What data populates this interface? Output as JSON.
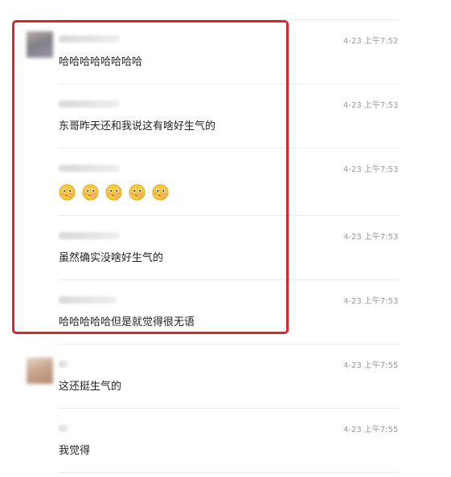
{
  "messages": [
    {
      "time": "4-23 上午7:52",
      "text": "哈哈哈哈哈哈哈哈"
    },
    {
      "time": "4-23 上午7:53",
      "text": "东哥昨天还和我说这有啥好生气的"
    },
    {
      "time": "4-23 上午7:53",
      "emoji": [
        "smiling-face-emoji",
        "smiling-face-emoji",
        "smiling-face-emoji",
        "smiling-face-emoji",
        "smiling-face-emoji"
      ]
    },
    {
      "time": "4-23 上午7:53",
      "text": "虽然确实没啥好生气的"
    },
    {
      "time": "4-23 上午7:53",
      "text": "哈哈哈哈哈但是就觉得很无语"
    },
    {
      "time": "4-23 上午7:55",
      "text": "这还挺生气的"
    },
    {
      "time": "4-23 上午7:55",
      "text": "我觉得"
    }
  ],
  "highlight_color": "#e0232a"
}
